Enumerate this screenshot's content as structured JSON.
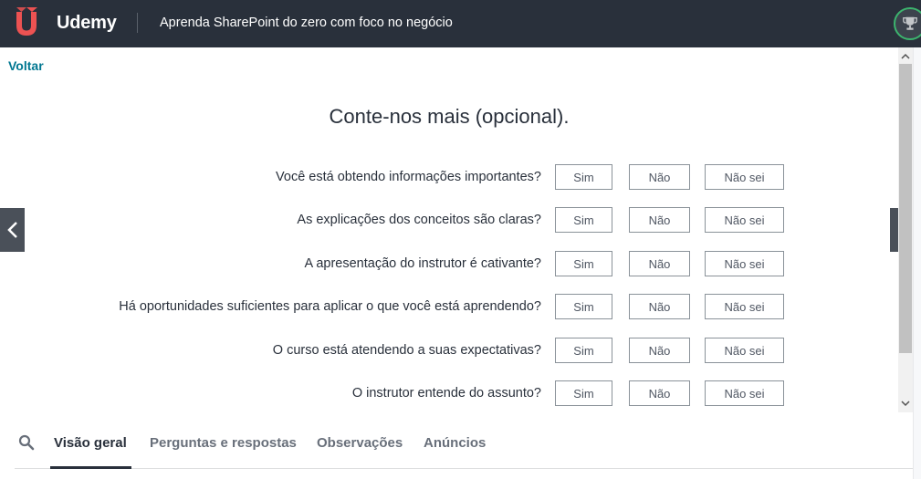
{
  "header": {
    "brand": "Udemy",
    "course_title": "Aprenda SharePoint do zero com foco no negócio",
    "colors": {
      "background": "#29303b",
      "brand_red": "#ec5252",
      "progress_ring": "#3cb46e"
    },
    "icons": [
      "udemy-logo-icon",
      "trophy-icon"
    ]
  },
  "back_label": "Voltar",
  "survey": {
    "title": "Conte-nos mais (opcional).",
    "options": {
      "yes": "Sim",
      "no": "Não",
      "dont_know": "Não sei"
    },
    "questions": [
      {
        "label": "Você está obtendo informações importantes?"
      },
      {
        "label": "As explicações dos conceitos são claras?"
      },
      {
        "label": "A apresentação do instrutor é cativante?"
      },
      {
        "label": "Há oportunidades suficientes para aplicar o que você está aprendendo?"
      },
      {
        "label": "O curso está atendendo a suas expectativas?"
      },
      {
        "label": "O instrutor entende do assunto?"
      }
    ]
  },
  "navigation": {
    "icons": [
      "chevron-left-icon",
      "chevron-right-icon"
    ]
  },
  "tabs": {
    "items": [
      {
        "label": "Visão geral",
        "active": true
      },
      {
        "label": "Perguntas e respostas",
        "active": false
      },
      {
        "label": "Observações",
        "active": false
      },
      {
        "label": "Anúncios",
        "active": false
      }
    ],
    "icons": [
      "search-icon"
    ]
  },
  "colors": {
    "link": "#007791",
    "text": "#29303b",
    "muted_text": "#686f7a"
  }
}
